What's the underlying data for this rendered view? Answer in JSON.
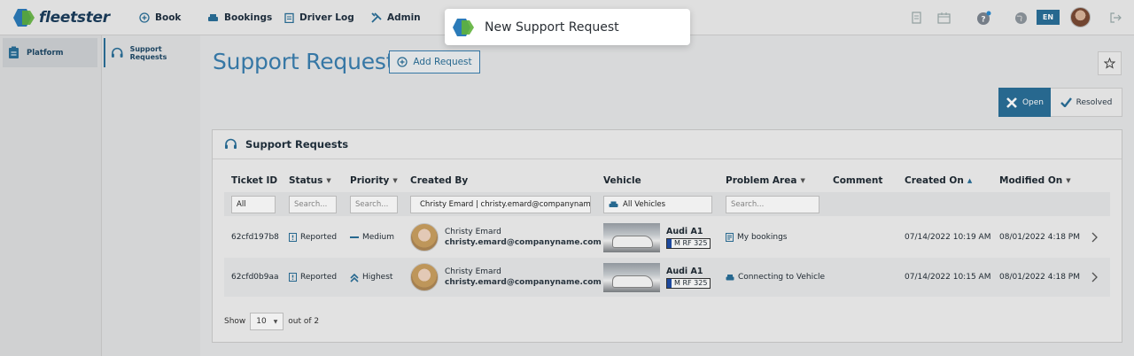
{
  "topbar": {
    "brand": "fleetster",
    "nav": [
      {
        "label": "Book",
        "icon": "plus-circle-icon"
      },
      {
        "label": "Bookings",
        "icon": "car-icon"
      },
      {
        "label": "Driver Log",
        "icon": "clipboard-icon"
      },
      {
        "label": "Admin",
        "icon": "tools-icon"
      }
    ],
    "language": "EN"
  },
  "modal": {
    "title": "New Support Request"
  },
  "sidebar": {
    "primary_item": "Platform",
    "secondary_item": "Support Requests"
  },
  "page": {
    "title": "Support Requests",
    "add_button": "Add Request"
  },
  "status_toggle": {
    "open": "Open",
    "resolved": "Resolved"
  },
  "card": {
    "title": "Support Requests",
    "columns": [
      "Ticket ID",
      "Status",
      "Priority",
      "Created By",
      "Vehicle",
      "Problem Area",
      "Comment",
      "Created On",
      "Modified On"
    ],
    "filters": {
      "ticket_id": "All",
      "status": "Search...",
      "priority": "Search...",
      "created_by": "Christy Emard | christy.emard@companyname.com",
      "vehicle": "All Vehicles",
      "problem_area": "Search..."
    },
    "rows": [
      {
        "ticket_id": "62cfd197b8",
        "status": "Reported",
        "priority": "Medium",
        "name": "Christy Emard",
        "email": "christy.emard@companyname.com",
        "vehicle": "Audi A1",
        "plate": "M RF 325",
        "problem_area": "My bookings",
        "comment": "",
        "created_on": "07/14/2022 10:19 AM",
        "modified_on": "08/01/2022 4:18 PM"
      },
      {
        "ticket_id": "62cfd0b9aa",
        "status": "Reported",
        "priority": "Highest",
        "name": "Christy Emard",
        "email": "christy.emard@companyname.com",
        "vehicle": "Audi A1",
        "plate": "M RF 325",
        "problem_area": "Connecting to Vehicle",
        "comment": "",
        "created_on": "07/14/2022 10:15 AM",
        "modified_on": "08/01/2022 4:18 PM"
      }
    ],
    "pagination": {
      "show_label": "Show",
      "page_size": "10",
      "out_of": "out of 2"
    }
  },
  "colors": {
    "accent": "#2a6f98",
    "title": "#3a7fb0",
    "brand": "#1b3d5c"
  }
}
